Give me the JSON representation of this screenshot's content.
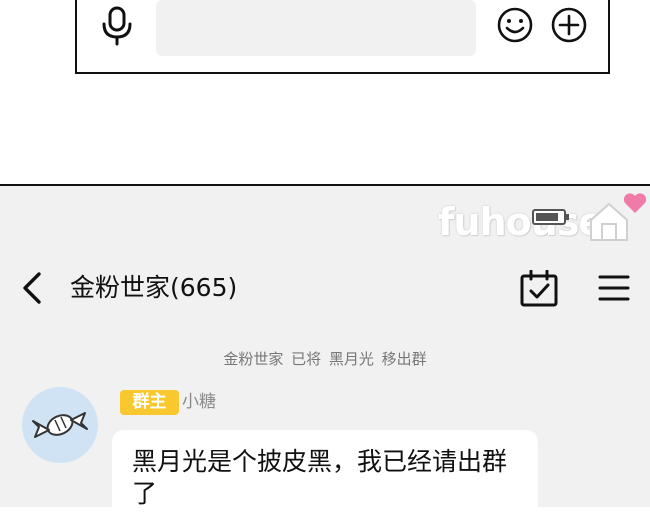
{
  "input_bar": {
    "mic_icon": "microphone-icon",
    "text_value": "",
    "emoji_icon": "smiley-icon",
    "plus_icon": "plus-circle-icon"
  },
  "watermark": {
    "text": "fuhouse"
  },
  "header": {
    "back_icon": "chevron-left-icon",
    "title": "金粉世家(665)",
    "calendar_icon": "calendar-check-icon",
    "menu_icon": "hamburger-menu-icon"
  },
  "chat": {
    "system_notice": "金粉世家 已将 黑月光 移出群",
    "messages": [
      {
        "badge": "群主",
        "sender": "小糖",
        "avatar_icon": "candy-icon",
        "text": "黑月光是个披皮黑，我已经请出群了"
      }
    ]
  },
  "colors": {
    "panel_background": "#f1f1f1",
    "badge_color": "#f9c72e",
    "avatar_background": "#cfe3f5",
    "heart_color": "#f07aa8"
  }
}
